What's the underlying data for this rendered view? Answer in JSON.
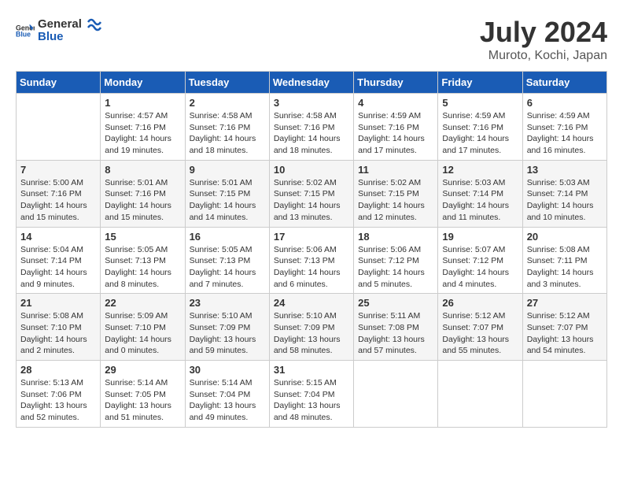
{
  "header": {
    "logo_general": "General",
    "logo_blue": "Blue",
    "month_year": "July 2024",
    "location": "Muroto, Kochi, Japan"
  },
  "days_of_week": [
    "Sunday",
    "Monday",
    "Tuesday",
    "Wednesday",
    "Thursday",
    "Friday",
    "Saturday"
  ],
  "weeks": [
    [
      {
        "day": null,
        "text": ""
      },
      {
        "day": "1",
        "text": "Sunrise: 4:57 AM\nSunset: 7:16 PM\nDaylight: 14 hours\nand 19 minutes."
      },
      {
        "day": "2",
        "text": "Sunrise: 4:58 AM\nSunset: 7:16 PM\nDaylight: 14 hours\nand 18 minutes."
      },
      {
        "day": "3",
        "text": "Sunrise: 4:58 AM\nSunset: 7:16 PM\nDaylight: 14 hours\nand 18 minutes."
      },
      {
        "day": "4",
        "text": "Sunrise: 4:59 AM\nSunset: 7:16 PM\nDaylight: 14 hours\nand 17 minutes."
      },
      {
        "day": "5",
        "text": "Sunrise: 4:59 AM\nSunset: 7:16 PM\nDaylight: 14 hours\nand 17 minutes."
      },
      {
        "day": "6",
        "text": "Sunrise: 4:59 AM\nSunset: 7:16 PM\nDaylight: 14 hours\nand 16 minutes."
      }
    ],
    [
      {
        "day": "7",
        "text": "Sunrise: 5:00 AM\nSunset: 7:16 PM\nDaylight: 14 hours\nand 15 minutes."
      },
      {
        "day": "8",
        "text": "Sunrise: 5:01 AM\nSunset: 7:16 PM\nDaylight: 14 hours\nand 15 minutes."
      },
      {
        "day": "9",
        "text": "Sunrise: 5:01 AM\nSunset: 7:15 PM\nDaylight: 14 hours\nand 14 minutes."
      },
      {
        "day": "10",
        "text": "Sunrise: 5:02 AM\nSunset: 7:15 PM\nDaylight: 14 hours\nand 13 minutes."
      },
      {
        "day": "11",
        "text": "Sunrise: 5:02 AM\nSunset: 7:15 PM\nDaylight: 14 hours\nand 12 minutes."
      },
      {
        "day": "12",
        "text": "Sunrise: 5:03 AM\nSunset: 7:14 PM\nDaylight: 14 hours\nand 11 minutes."
      },
      {
        "day": "13",
        "text": "Sunrise: 5:03 AM\nSunset: 7:14 PM\nDaylight: 14 hours\nand 10 minutes."
      }
    ],
    [
      {
        "day": "14",
        "text": "Sunrise: 5:04 AM\nSunset: 7:14 PM\nDaylight: 14 hours\nand 9 minutes."
      },
      {
        "day": "15",
        "text": "Sunrise: 5:05 AM\nSunset: 7:13 PM\nDaylight: 14 hours\nand 8 minutes."
      },
      {
        "day": "16",
        "text": "Sunrise: 5:05 AM\nSunset: 7:13 PM\nDaylight: 14 hours\nand 7 minutes."
      },
      {
        "day": "17",
        "text": "Sunrise: 5:06 AM\nSunset: 7:13 PM\nDaylight: 14 hours\nand 6 minutes."
      },
      {
        "day": "18",
        "text": "Sunrise: 5:06 AM\nSunset: 7:12 PM\nDaylight: 14 hours\nand 5 minutes."
      },
      {
        "day": "19",
        "text": "Sunrise: 5:07 AM\nSunset: 7:12 PM\nDaylight: 14 hours\nand 4 minutes."
      },
      {
        "day": "20",
        "text": "Sunrise: 5:08 AM\nSunset: 7:11 PM\nDaylight: 14 hours\nand 3 minutes."
      }
    ],
    [
      {
        "day": "21",
        "text": "Sunrise: 5:08 AM\nSunset: 7:10 PM\nDaylight: 14 hours\nand 2 minutes."
      },
      {
        "day": "22",
        "text": "Sunrise: 5:09 AM\nSunset: 7:10 PM\nDaylight: 14 hours\nand 0 minutes."
      },
      {
        "day": "23",
        "text": "Sunrise: 5:10 AM\nSunset: 7:09 PM\nDaylight: 13 hours\nand 59 minutes."
      },
      {
        "day": "24",
        "text": "Sunrise: 5:10 AM\nSunset: 7:09 PM\nDaylight: 13 hours\nand 58 minutes."
      },
      {
        "day": "25",
        "text": "Sunrise: 5:11 AM\nSunset: 7:08 PM\nDaylight: 13 hours\nand 57 minutes."
      },
      {
        "day": "26",
        "text": "Sunrise: 5:12 AM\nSunset: 7:07 PM\nDaylight: 13 hours\nand 55 minutes."
      },
      {
        "day": "27",
        "text": "Sunrise: 5:12 AM\nSunset: 7:07 PM\nDaylight: 13 hours\nand 54 minutes."
      }
    ],
    [
      {
        "day": "28",
        "text": "Sunrise: 5:13 AM\nSunset: 7:06 PM\nDaylight: 13 hours\nand 52 minutes."
      },
      {
        "day": "29",
        "text": "Sunrise: 5:14 AM\nSunset: 7:05 PM\nDaylight: 13 hours\nand 51 minutes."
      },
      {
        "day": "30",
        "text": "Sunrise: 5:14 AM\nSunset: 7:04 PM\nDaylight: 13 hours\nand 49 minutes."
      },
      {
        "day": "31",
        "text": "Sunrise: 5:15 AM\nSunset: 7:04 PM\nDaylight: 13 hours\nand 48 minutes."
      },
      {
        "day": null,
        "text": ""
      },
      {
        "day": null,
        "text": ""
      },
      {
        "day": null,
        "text": ""
      }
    ]
  ]
}
